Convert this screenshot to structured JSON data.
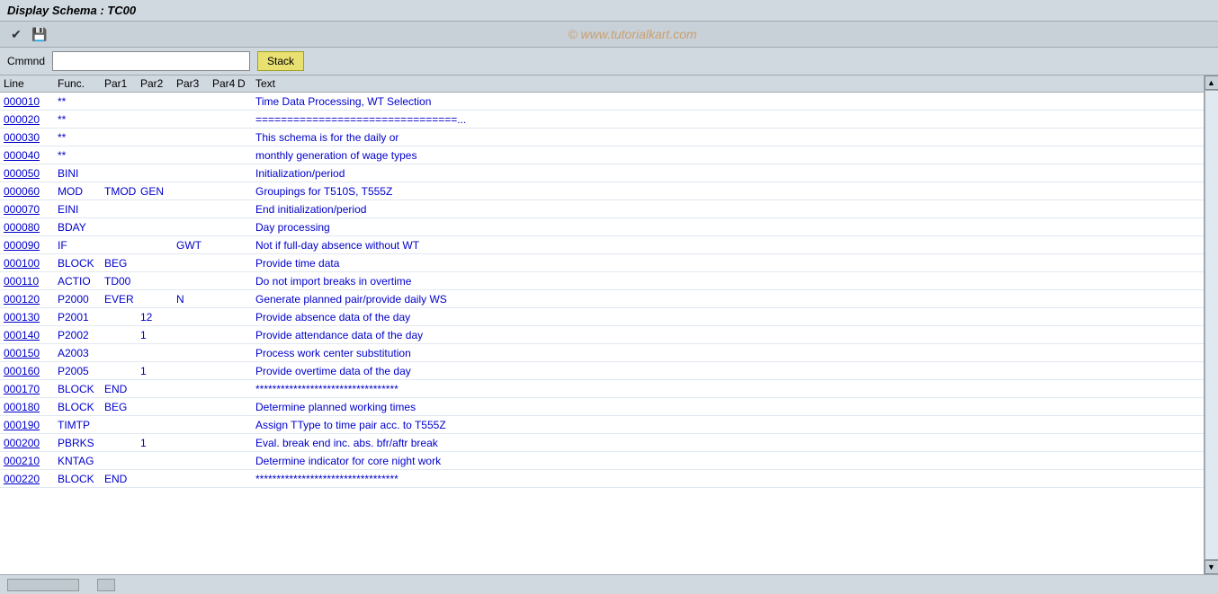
{
  "title_bar": {
    "label": "Display Schema : TC00"
  },
  "toolbar": {
    "icons": [
      {
        "name": "check-icon",
        "symbol": "✔"
      },
      {
        "name": "save-icon",
        "symbol": "💾"
      }
    ],
    "watermark": "© www.tutorialkart.com"
  },
  "command_bar": {
    "label": "Cmmnd",
    "input_value": "",
    "input_placeholder": "",
    "stack_button": "Stack"
  },
  "col_headers": {
    "line": "Line",
    "func": "Func.",
    "par1": "Par1",
    "par2": "Par2",
    "par3": "Par3",
    "par4": "Par4",
    "d": "D",
    "text": "Text"
  },
  "rows": [
    {
      "line": "000010",
      "func": "**",
      "par1": "",
      "par2": "",
      "par3": "",
      "par4": "",
      "d": "",
      "text": "Time Data Processing, WT Selection"
    },
    {
      "line": "000020",
      "func": "**",
      "par1": "",
      "par2": "",
      "par3": "",
      "par4": "",
      "d": "",
      "text": "================================..."
    },
    {
      "line": "000030",
      "func": "**",
      "par1": "",
      "par2": "",
      "par3": "",
      "par4": "",
      "d": "",
      "text": "This schema is for the daily or"
    },
    {
      "line": "000040",
      "func": "**",
      "par1": "",
      "par2": "",
      "par3": "",
      "par4": "",
      "d": "",
      "text": "monthly generation of wage types"
    },
    {
      "line": "000050",
      "func": "BINI",
      "par1": "",
      "par2": "",
      "par3": "",
      "par4": "",
      "d": "",
      "text": "Initialization/period"
    },
    {
      "line": "000060",
      "func": "MOD",
      "par1": "TMOD",
      "par2": "GEN",
      "par3": "",
      "par4": "",
      "d": "",
      "text": "Groupings for T510S, T555Z"
    },
    {
      "line": "000070",
      "func": "EINI",
      "par1": "",
      "par2": "",
      "par3": "",
      "par4": "",
      "d": "",
      "text": "End initialization/period"
    },
    {
      "line": "000080",
      "func": "BDAY",
      "par1": "",
      "par2": "",
      "par3": "",
      "par4": "",
      "d": "",
      "text": "Day processing"
    },
    {
      "line": "000090",
      "func": "IF",
      "par1": "",
      "par2": "",
      "par3": "GWT",
      "par4": "",
      "d": "",
      "text": "Not if full-day absence without WT"
    },
    {
      "line": "000100",
      "func": "BLOCK",
      "par1": "BEG",
      "par2": "",
      "par3": "",
      "par4": "",
      "d": "",
      "text": "Provide time data"
    },
    {
      "line": "000110",
      "func": "ACTIO",
      "par1": "TD00",
      "par2": "",
      "par3": "",
      "par4": "",
      "d": "",
      "text": "Do not import breaks in overtime"
    },
    {
      "line": "000120",
      "func": "P2000",
      "par1": "EVER",
      "par2": "",
      "par3": "N",
      "par4": "",
      "d": "",
      "text": "Generate planned pair/provide daily WS"
    },
    {
      "line": "000130",
      "func": "P2001",
      "par1": "",
      "par2": "12",
      "par3": "",
      "par4": "",
      "d": "",
      "text": "Provide absence data of the day"
    },
    {
      "line": "000140",
      "func": "P2002",
      "par1": "",
      "par2": "1",
      "par3": "",
      "par4": "",
      "d": "",
      "text": "Provide attendance data of the day"
    },
    {
      "line": "000150",
      "func": "A2003",
      "par1": "",
      "par2": "",
      "par3": "",
      "par4": "",
      "d": "",
      "text": "Process work center substitution"
    },
    {
      "line": "000160",
      "func": "P2005",
      "par1": "",
      "par2": "1",
      "par3": "",
      "par4": "",
      "d": "",
      "text": "Provide overtime data of the day"
    },
    {
      "line": "000170",
      "func": "BLOCK",
      "par1": "END",
      "par2": "",
      "par3": "",
      "par4": "",
      "d": "",
      "text": "**********************************"
    },
    {
      "line": "000180",
      "func": "BLOCK",
      "par1": "BEG",
      "par2": "",
      "par3": "",
      "par4": "",
      "d": "",
      "text": "Determine planned working times"
    },
    {
      "line": "000190",
      "func": "TIMTP",
      "par1": "",
      "par2": "",
      "par3": "",
      "par4": "",
      "d": "",
      "text": "Assign TType to time pair acc. to T555Z"
    },
    {
      "line": "000200",
      "func": "PBRKS",
      "par1": "",
      "par2": "1",
      "par3": "",
      "par4": "",
      "d": "",
      "text": "Eval. break end inc. abs. bfr/aftr break"
    },
    {
      "line": "000210",
      "func": "KNTAG",
      "par1": "",
      "par2": "",
      "par3": "",
      "par4": "",
      "d": "",
      "text": "Determine indicator for core night work"
    },
    {
      "line": "000220",
      "func": "BLOCK",
      "par1": "END",
      "par2": "",
      "par3": "",
      "par4": "",
      "d": "",
      "text": "**********************************"
    }
  ]
}
